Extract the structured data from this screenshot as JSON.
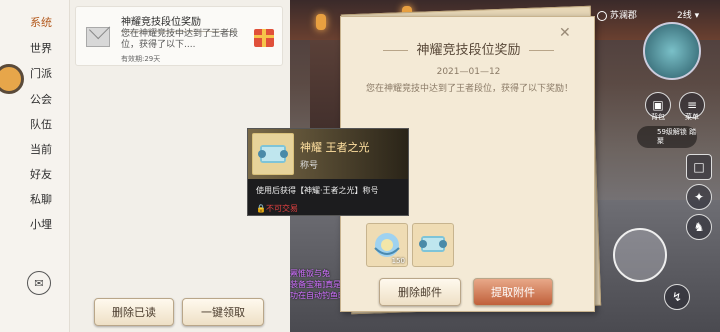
{
  "tabs": [
    {
      "label": "系统"
    },
    {
      "label": "世界"
    },
    {
      "label": "门派"
    },
    {
      "label": "公会"
    },
    {
      "label": "队伍"
    },
    {
      "label": "当前"
    },
    {
      "label": "好友"
    },
    {
      "label": "私聊"
    },
    {
      "label": "小埋"
    }
  ],
  "mail_list": {
    "item": {
      "title": "神耀竞技段位奖励",
      "preview": "您在神耀竞技中达到了王者段位，获得了以下....",
      "validity": "有效期:29天"
    },
    "delete_read_label": "删除已读",
    "claim_all_label": "一键领取"
  },
  "detail": {
    "title": "神耀竞技段位奖励",
    "date": "2021—01—12",
    "body": "您在神耀竞技中达到了王者段位，获得了以下奖励！",
    "attachments": [
      {
        "icon": "conch-item-icon",
        "count": "150"
      },
      {
        "icon": "scroll-title-icon",
        "count": ""
      }
    ],
    "delete_mail_label": "删除邮件",
    "extract_label": "提取附件",
    "close_glyph": "✕"
  },
  "tooltip": {
    "name": "神耀 王者之光",
    "type": "称号",
    "description": "使用后获得【神耀·王者之光】称号",
    "restriction": "不可交易"
  },
  "hud": {
    "location": "苏澜郡",
    "channel": "2线 ▾",
    "bag_label": "背包",
    "menu_label": "菜单",
    "unlock_chip": "59级解锁\n踏聚"
  },
  "chat_lines": [
    "罴惟饭与兔",
    "装备宝箱]真是",
    "功在自动钓鱼时获得了[精良装备宝箱]真是欧气爆棚!"
  ],
  "colors": {
    "accent": "#b35a1e",
    "parchment": "#f4ead6",
    "warning": "#e04040"
  }
}
